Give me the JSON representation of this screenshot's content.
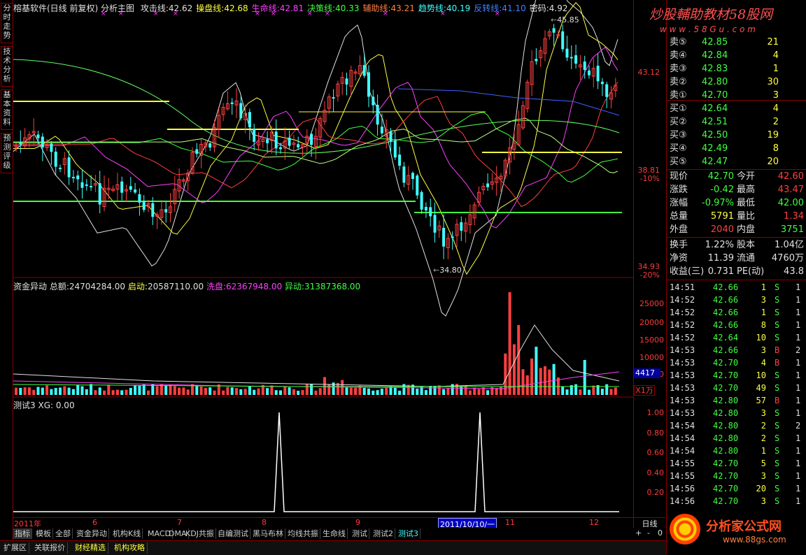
{
  "sidebar": {
    "tabs": [
      "分时走势",
      "技术分析",
      "基本资料",
      "预测评级"
    ]
  },
  "main_header": {
    "stock": "榕基软件(日线 前复权)",
    "indicator_name": "分析主图",
    "items": [
      {
        "label": "攻击线:",
        "value": "42.62",
        "color": "#e0e0e0"
      },
      {
        "label": "操盘线:",
        "value": "42.68",
        "color": "#ffff40"
      },
      {
        "label": "生命线:",
        "value": "42.81",
        "color": "#ff40ff"
      },
      {
        "label": "决策线:",
        "value": "40.33",
        "color": "#40ff40"
      },
      {
        "label": "辅助线:",
        "value": "43.21",
        "color": "#ff8040"
      },
      {
        "label": "趋势线:",
        "value": "40.19",
        "color": "#40ffff"
      },
      {
        "label": "反转线:",
        "value": "41.10",
        "color": "#4080ff"
      },
      {
        "label": "密码:",
        "value": "4.92",
        "color": "#e0e0e0"
      }
    ],
    "high_marker": "45.85",
    "low_marker": "34.80"
  },
  "main_yaxis": [
    "43.12",
    "38.81",
    "-10%",
    "34.93",
    "-20%"
  ],
  "volume_panel": {
    "title": "资金异动",
    "total_label": "总额:",
    "total_value": "24704284.00",
    "start_label": "启动:",
    "start_value": "20587110.00",
    "wash_label": "洗盘:",
    "wash_value": "62367948.00",
    "move_label": "异动:",
    "move_value": "31387368.00",
    "yaxis": [
      "25000",
      "20000",
      "15000",
      "10000",
      "5000"
    ],
    "current_badge": "4417",
    "unit": "X1万"
  },
  "test_panel": {
    "title": "测试3",
    "xg_label": "XG:",
    "xg_value": "0.00",
    "yaxis": [
      "1.00",
      "0.80",
      "0.60",
      "0.40",
      "0.20"
    ]
  },
  "xaxis": {
    "labels": [
      "2011年",
      "6",
      "7",
      "8",
      "9",
      "11",
      "12"
    ],
    "highlight": "2011/10/10/一",
    "period": "日线"
  },
  "indicator_tabs": [
    "指标",
    "模板",
    "全部",
    "资金异动",
    "机构K线",
    "MACD",
    "DMA",
    "KDJ共振",
    "自编测试",
    "黑马布林",
    "均线共振",
    "生命线",
    "测试",
    "测试2",
    "测试3"
  ],
  "bottom_tabs": [
    "扩展区",
    "关联报价",
    "财经精选",
    "机构攻略"
  ],
  "nav_buttons": [
    "+",
    "-",
    "0"
  ],
  "watermark_top": "炒股輔助教材58股网",
  "watermark_url": "w w w . 5 8 G u . c o m",
  "watermark_bottom": "分析家公式网",
  "watermark_bottom_url": "www.88gs.com",
  "order_book": {
    "sell": [
      {
        "label": "卖⑤",
        "price": "42.85",
        "vol": "21"
      },
      {
        "label": "卖④",
        "price": "42.84",
        "vol": "4"
      },
      {
        "label": "卖③",
        "price": "42.83",
        "vol": "1"
      },
      {
        "label": "卖②",
        "price": "42.80",
        "vol": "30"
      },
      {
        "label": "卖①",
        "price": "42.70",
        "vol": "3"
      }
    ],
    "buy": [
      {
        "label": "买①",
        "price": "42.64",
        "vol": "4"
      },
      {
        "label": "买②",
        "price": "42.51",
        "vol": "2"
      },
      {
        "label": "买③",
        "price": "42.50",
        "vol": "19"
      },
      {
        "label": "买④",
        "price": "42.49",
        "vol": "8"
      },
      {
        "label": "买⑤",
        "price": "42.47",
        "vol": "20"
      }
    ]
  },
  "quote_stats": [
    {
      "l1": "现价",
      "v1": "42.70",
      "c1": "#40ff40",
      "l2": "今开",
      "v2": "42.60",
      "c2": "#ff4040"
    },
    {
      "l1": "涨跌",
      "v1": "-0.42",
      "c1": "#40ff40",
      "l2": "最高",
      "v2": "43.47",
      "c2": "#ff4040"
    },
    {
      "l1": "涨幅",
      "v1": "-0.97%",
      "c1": "#40ff40",
      "l2": "最低",
      "v2": "42.00",
      "c2": "#40ff40"
    },
    {
      "l1": "总量",
      "v1": "5791",
      "c1": "#ffff40",
      "l2": "量比",
      "v2": "1.34",
      "c2": "#ff4040"
    },
    {
      "l1": "外盘",
      "v1": "2040",
      "c1": "#ff4040",
      "l2": "内盘",
      "v2": "3751",
      "c2": "#40ff40"
    }
  ],
  "fundamentals": [
    {
      "l1": "换手",
      "v1": "1.22%",
      "l2": "股本",
      "v2": "1.04亿"
    },
    {
      "l1": "净资",
      "v1": "11.39",
      "l2": "流通",
      "v2": "4760万"
    },
    {
      "l1": "收益(三)",
      "v1": "0.731",
      "l2": "PE(动)",
      "v2": "43.8"
    }
  ],
  "ticks": [
    {
      "time": "14:51",
      "price": "42.66",
      "vol": "1",
      "side": "S",
      "n": "1"
    },
    {
      "time": "14:52",
      "price": "42.66",
      "vol": "3",
      "side": "S",
      "n": "1"
    },
    {
      "time": "14:52",
      "price": "42.66",
      "vol": "1",
      "side": "S",
      "n": "1"
    },
    {
      "time": "14:52",
      "price": "42.66",
      "vol": "8",
      "side": "S",
      "n": "1"
    },
    {
      "time": "14:52",
      "price": "42.64",
      "vol": "10",
      "side": "S",
      "n": "1"
    },
    {
      "time": "14:53",
      "price": "42.66",
      "vol": "3",
      "side": "B",
      "n": "2"
    },
    {
      "time": "14:53",
      "price": "42.70",
      "vol": "4",
      "side": "B",
      "n": "1"
    },
    {
      "time": "14:53",
      "price": "42.70",
      "vol": "10",
      "side": "S",
      "n": "1"
    },
    {
      "time": "14:53",
      "price": "42.70",
      "vol": "49",
      "side": "S",
      "n": "1"
    },
    {
      "time": "14:53",
      "price": "42.80",
      "vol": "57",
      "side": "B",
      "n": "1"
    },
    {
      "time": "14:53",
      "price": "42.80",
      "vol": "3",
      "side": "S",
      "n": "1"
    },
    {
      "time": "14:54",
      "price": "42.80",
      "vol": "2",
      "side": "S",
      "n": "2"
    },
    {
      "time": "14:54",
      "price": "42.80",
      "vol": "2",
      "side": "S",
      "n": "1"
    },
    {
      "time": "14:54",
      "price": "42.80",
      "vol": "1",
      "side": "S",
      "n": "1"
    },
    {
      "time": "14:55",
      "price": "42.70",
      "vol": "5",
      "side": "S",
      "n": "1"
    },
    {
      "time": "14:55",
      "price": "42.70",
      "vol": "3",
      "side": "S",
      "n": "1"
    },
    {
      "time": "14:56",
      "price": "42.70",
      "vol": "20",
      "side": "S",
      "n": "1"
    },
    {
      "time": "14:56",
      "price": "42.70",
      "vol": "3",
      "side": "S",
      "n": "1"
    }
  ],
  "colors": {
    "up": "#ff4040",
    "down": "#40ffff",
    "border": "#8a0000",
    "axis_text": "#ff3a3a"
  }
}
